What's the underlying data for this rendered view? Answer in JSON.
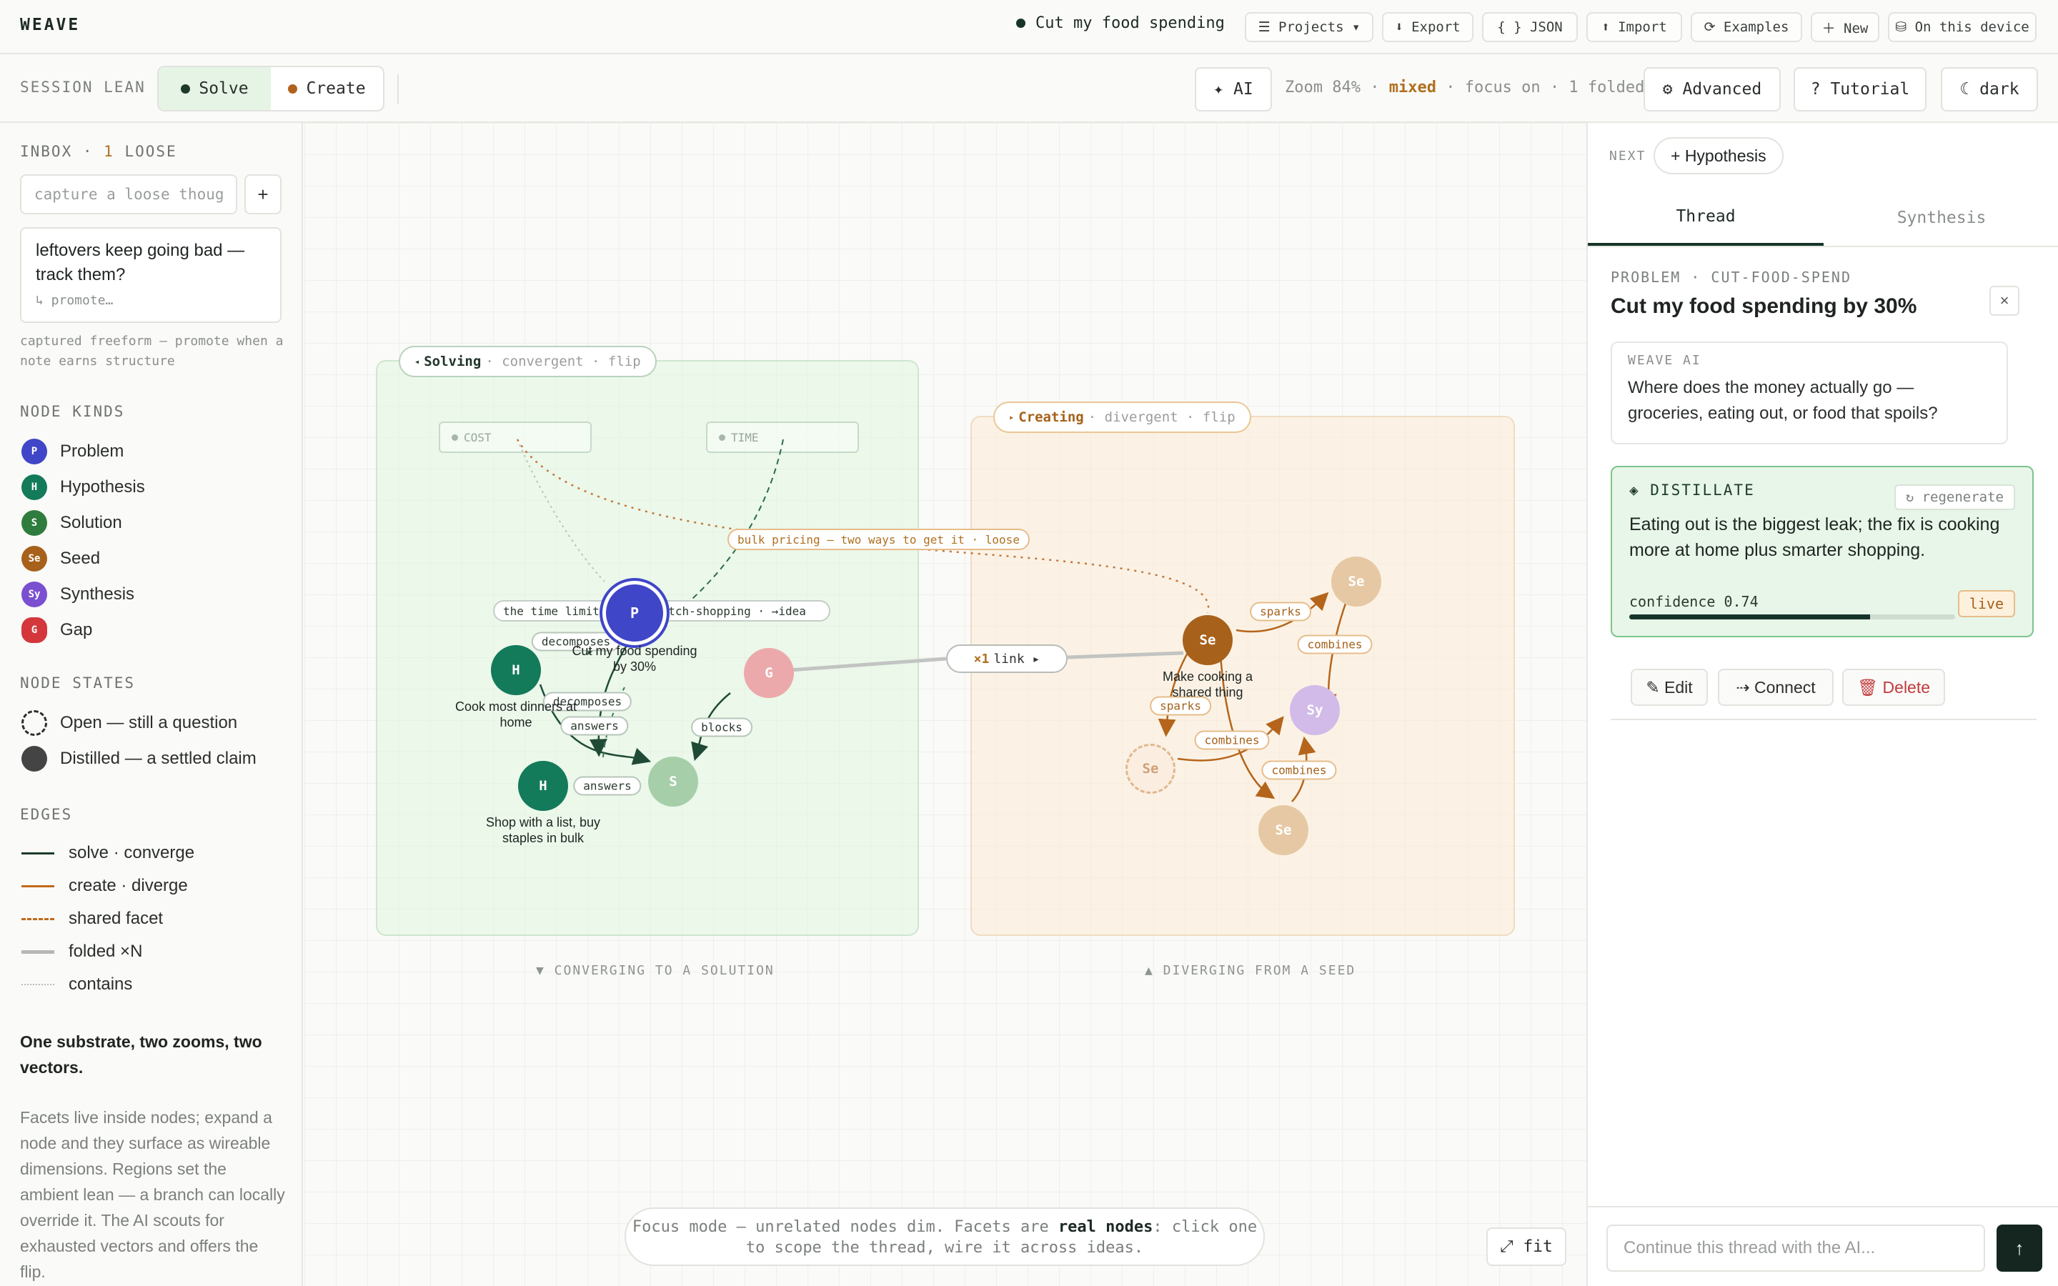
{
  "app": {
    "logo": "WEAVE"
  },
  "topbar": {
    "doc_title": "Cut my food spending",
    "buttons": [
      {
        "icon": "menu-icon",
        "label": "☰ Projects ▾"
      },
      {
        "icon": "download-icon",
        "label": "⬇ Export"
      },
      {
        "icon": "braces-icon",
        "label": "{ } JSON"
      },
      {
        "icon": "upload-icon",
        "label": "⬆ Import"
      },
      {
        "icon": "refresh-icon",
        "label": "⟳ Examples"
      },
      {
        "icon": "plus-icon",
        "label": "＋ New"
      },
      {
        "icon": "storage-icon",
        "label": "⛁ On this device"
      }
    ]
  },
  "subbar": {
    "lean_label": "SESSION LEAN",
    "solve_label": "Solve",
    "create_label": "Create",
    "ai_label": "✦ AI",
    "status": {
      "zoom": "Zoom 84%",
      "mode": "mixed",
      "rest": "focus on · 1 folded"
    },
    "advanced_label": "⚙ Advanced",
    "tutorial_label": "? Tutorial",
    "theme_label": "☾ dark"
  },
  "sidebar": {
    "inbox_label": "INBOX ·",
    "inbox_count": "1",
    "inbox_suffix": "LOOSE",
    "input_placeholder": "capture a loose thought",
    "add_label": "+",
    "note": {
      "text": "leftovers keep going bad — track them?",
      "action": "↳ promote…"
    },
    "caption": "captured freeform — promote when a note earns structure",
    "kinds_label": "NODE KINDS",
    "kinds": [
      {
        "badge": "P",
        "name": "Problem",
        "color": "#3f46c8"
      },
      {
        "badge": "H",
        "name": "Hypothesis",
        "color": "#137a5a"
      },
      {
        "badge": "S",
        "name": "Solution",
        "color": "#2f7d3e"
      },
      {
        "badge": "Se",
        "name": "Seed",
        "color": "#a8611b"
      },
      {
        "badge": "Sy",
        "name": "Synthesis",
        "color": "#7a4fd0"
      },
      {
        "badge": "G",
        "name": "Gap",
        "color": "#d3373c"
      }
    ],
    "states_label": "NODE STATES",
    "states": [
      {
        "name": "Open — still a question"
      },
      {
        "name": "Distilled — a settled claim"
      }
    ],
    "edges_label": "EDGES",
    "edges": [
      {
        "name": "solve · converge",
        "color": "#1d3a2a"
      },
      {
        "name": "create · diverge",
        "color": "#c06a1a"
      },
      {
        "name": "shared facet",
        "color": "#c06a1a"
      },
      {
        "name": "folded ×N",
        "color": "#b5b8b5"
      },
      {
        "name": "contains",
        "color": "#b8bcb8"
      }
    ],
    "tagline": "One substrate, two zooms, two vectors.",
    "description": "Facets live inside nodes; expand a node and they surface as wireable dimensions. Regions set the ambient lean — a branch can locally override it. The AI scouts for exhausted vectors and offers the flip."
  },
  "canvas": {
    "solve_region": {
      "name": "Solving",
      "sub": "· convergent · flip",
      "footer": "▼ CONVERGING TO A SOLUTION"
    },
    "create_region": {
      "name": "Creating",
      "sub": "· divergent · flip",
      "footer": "▲ DIVERGING FROM A SEED"
    },
    "facets": [
      {
        "label": "COST"
      },
      {
        "label": "TIME"
      }
    ],
    "shared_label": "bulk pricing — two ways to get it · loose",
    "contains_label": "the time limit pushed batch-shopping · →idea",
    "link_badge": {
      "count": "×1",
      "text": "link ▸"
    },
    "nodes": {
      "problem": {
        "badge": "P",
        "label": "Cut my food spending by 30%"
      },
      "h1": {
        "badge": "H",
        "label": "Cook most dinners at home"
      },
      "h2": {
        "badge": "H",
        "label": "Shop with a list, buy staples in bulk"
      },
      "gap": {
        "badge": "G"
      },
      "solution": {
        "badge": "S"
      },
      "seed": {
        "badge": "Se",
        "label": "Make cooking a shared thing"
      },
      "seed_tr": {
        "badge": "Se"
      },
      "synth": {
        "badge": "Sy"
      },
      "seed_open": {
        "badge": "Se"
      },
      "seed_b": {
        "badge": "Se"
      }
    },
    "edge_labels": {
      "decomposes_1": "decomposes",
      "decomposes_2": "decomposes",
      "answers_1": "answers",
      "answers_2": "answers",
      "blocks": "blocks",
      "sparks_1": "sparks",
      "sparks_2": "sparks",
      "combines_1": "combines",
      "combines_2": "combines",
      "combines_3": "combines"
    },
    "focus_toast": {
      "before": "Focus mode — unrelated nodes dim. Facets are ",
      "bold": "real nodes",
      "after": ": click one to scope the thread, wire it across ideas."
    },
    "fit_label": "⤢ fit"
  },
  "panel": {
    "next_label": "NEXT",
    "next_button": "+ Hypothesis",
    "tabs": [
      "Thread",
      "Synthesis"
    ],
    "kicker": "PROBLEM · CUT-FOOD-SPEND",
    "title": "Cut my food spending by 30%",
    "close_label": "×",
    "ai_kicker": "WEAVE AI",
    "ai_text": "Where does the money actually go — groceries, eating out, or food that spoils?",
    "distill": {
      "kicker": "◈ DISTILLATE",
      "regen": "↻ regenerate",
      "text": "Eating out is the biggest leak; the fix is cooking more at home plus smarter shopping.",
      "confidence_label": "confidence 0.74",
      "confidence": 0.74,
      "badge": "live"
    },
    "actions": {
      "edit": "✎ Edit",
      "connect": "⇢ Connect",
      "delete": "🗑 Delete"
    },
    "composer_placeholder": "Continue this thread with the AI...",
    "send_label": "↑"
  }
}
